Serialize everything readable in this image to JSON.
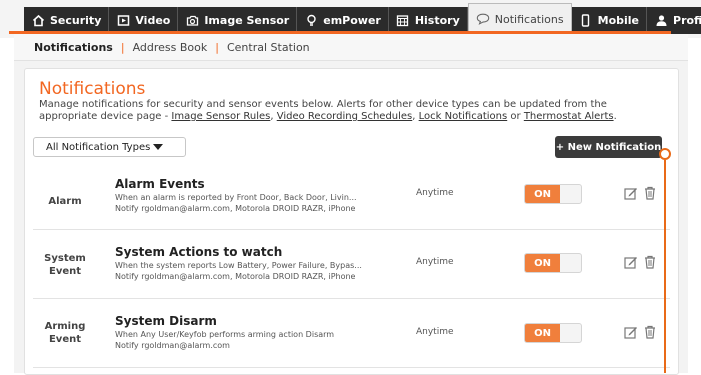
{
  "nav": {
    "tabs": [
      {
        "label": "Security",
        "icon": "home-icon"
      },
      {
        "label": "Video",
        "icon": "video-icon"
      },
      {
        "label": "Image Sensor",
        "icon": "camera-icon"
      },
      {
        "label": "emPower",
        "icon": "lightbulb-icon"
      },
      {
        "label": "History",
        "icon": "calendar-icon"
      },
      {
        "label": "Notifications",
        "icon": "speech-bubble-icon",
        "active": true
      },
      {
        "label": "Mobile",
        "icon": "phone-icon"
      },
      {
        "label": "Profile",
        "icon": "user-icon"
      }
    ]
  },
  "subnav": {
    "items": [
      "Notifications",
      "Address Book",
      "Central Station"
    ],
    "separator": "|"
  },
  "main": {
    "title": "Notifications",
    "description_prefix": "Manage notifications for security and sensor events below. Alerts for other device types can be updated from the appropriate device page - ",
    "links": [
      "Image Sensor Rules",
      "Video Recording Schedules",
      "Lock Notifications",
      "Thermostat Alerts"
    ],
    "comma": ", ",
    "or": " or ",
    "period": ".",
    "filter": {
      "selected": "All Notification Types"
    },
    "new_button": "+ New Notification"
  },
  "rows": [
    {
      "type_line1": "Alarm",
      "type_line2": "",
      "title": "Alarm Events",
      "desc1": "When an alarm is reported by Front Door, Back Door, Livin...",
      "desc2": "Notify rgoldman@alarm.com, Motorola DROID RAZR, iPhone",
      "when": "Anytime",
      "toggle": "ON"
    },
    {
      "type_line1": "System",
      "type_line2": "Event",
      "title": "System Actions to watch",
      "desc1": "When the system reports Low Battery, Power Failure, Bypas...",
      "desc2": "Notify rgoldman@alarm.com, Motorola DROID RAZR, iPhone",
      "when": "Anytime",
      "toggle": "ON"
    },
    {
      "type_line1": "Arming",
      "type_line2": "Event",
      "title": "System Disarm",
      "desc1": "When Any User/Keyfob performs arming action Disarm",
      "desc2": "Notify rgoldman@alarm.com",
      "when": "Anytime",
      "toggle": "ON"
    }
  ],
  "colors": {
    "accent": "#f26722",
    "nav_bg": "#2b2b2b",
    "toggle_on": "#f07f3c",
    "callout": "#e96a18"
  }
}
